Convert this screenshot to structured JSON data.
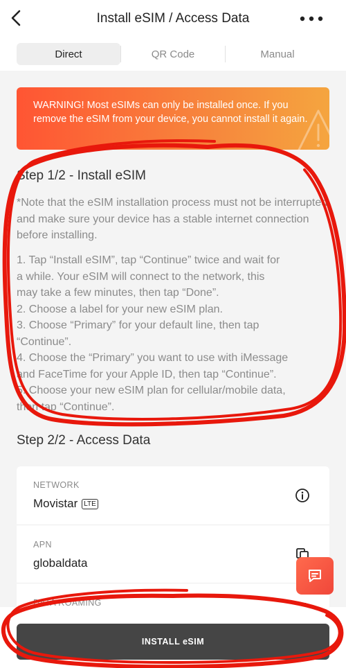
{
  "header": {
    "title": "Install eSIM / Access Data",
    "tabs": [
      {
        "label": "Direct",
        "active": true
      },
      {
        "label": "QR Code",
        "active": false
      },
      {
        "label": "Manual",
        "active": false
      }
    ]
  },
  "warning": {
    "text": "WARNING! Most eSIMs can only be installed once. If you remove the eSIM from your device, you cannot install it again."
  },
  "step1": {
    "title": "Step 1/2 - Install eSIM",
    "note": "*Note that the eSIM installation process must not be interrupted and make sure your device has a stable internet connection before installing.",
    "lines": [
      "1. Tap “Install eSIM”, tap “Continue” twice and wait for",
      "a while. Your eSIM will connect to the network, this",
      "may take a few minutes, then tap “Done”.",
      "2. Choose a label for your new eSIM plan.",
      "3. Choose “Primary” for your default line, then tap",
      "“Continue”.",
      "4. Choose the “Primary” you want to use with iMessage",
      "and FaceTime for your Apple ID, then tap “Continue”.",
      "5. Choose your new eSIM plan for cellular/mobile data,",
      "then tap “Continue”."
    ]
  },
  "step2": {
    "title": "Step 2/2 - Access Data",
    "rows": [
      {
        "label": "NETWORK",
        "value": "Movistar",
        "badge": "LTE",
        "icon": "info-icon"
      },
      {
        "label": "APN",
        "value": "globaldata",
        "icon": "copy-icon"
      },
      {
        "label": "DATA ROAMING",
        "value": "",
        "icon": "toggle-icon"
      }
    ]
  },
  "install_button": {
    "label": "INSTALL eSIM"
  },
  "colors": {
    "warning_start": "#ff5533",
    "warning_end": "#f5a53f",
    "button": "#454545",
    "chat": "#f0473a",
    "annotation": "#e8180c"
  }
}
